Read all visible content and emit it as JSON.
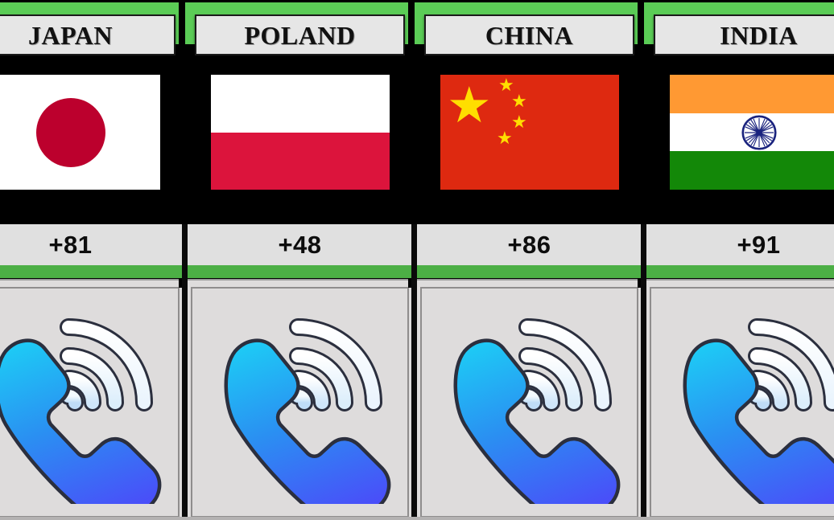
{
  "theme": {
    "background": "#000000",
    "band_green": "#5bcc56",
    "band_green_mid": "#4caf45",
    "plate_bg": "#e6e6e6",
    "code_plate_bg": "#e0e0e0",
    "panel_bg": "#dedcdc",
    "text_color": "#111111",
    "phone_gradient_top": "#22b8f0",
    "phone_gradient_bottom": "#4a5cf8",
    "wave_outer": "#fdfdfd",
    "wave_inner": "#cfe8fb"
  },
  "columns": [
    {
      "country": "JAPAN",
      "dial_code": "+81",
      "flag": "japan-flag",
      "icon": "phone-call-icon"
    },
    {
      "country": "POLAND",
      "dial_code": "+48",
      "flag": "poland-flag",
      "icon": "phone-call-icon"
    },
    {
      "country": "CHINA",
      "dial_code": "+86",
      "flag": "china-flag",
      "icon": "phone-call-icon"
    },
    {
      "country": "INDIA",
      "dial_code": "+91",
      "flag": "india-flag",
      "icon": "phone-call-icon"
    }
  ]
}
